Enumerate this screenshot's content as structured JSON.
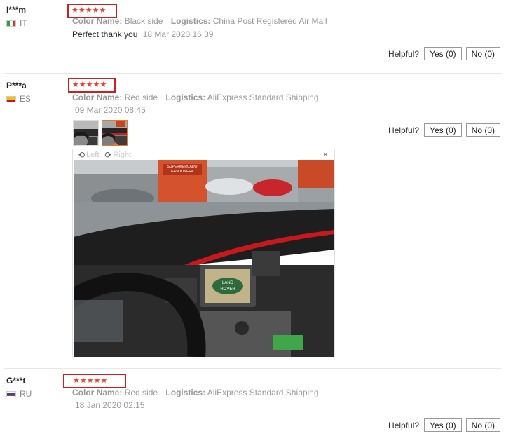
{
  "reviews": [
    {
      "user": "I***m",
      "country": "IT",
      "stars": "★★★★★",
      "meta": [
        {
          "label": "Color Name:",
          "value": "Black side"
        },
        {
          "label": "Logistics:",
          "value": "China Post Registered Air Mail"
        }
      ],
      "feedback": "Perfect thank you",
      "date": "18 Mar 2020 16:39",
      "helpful_label": "Helpful?",
      "yes_label": "Yes (0)",
      "no_label": "No (0)"
    },
    {
      "user": "P***a",
      "country": "ES",
      "stars": "★★★★★",
      "meta": [
        {
          "label": "Color Name:",
          "value": "Red side"
        },
        {
          "label": "Logistics:",
          "value": "AliExpress Standard Shipping"
        }
      ],
      "date": "09 Mar 2020 08:45",
      "helpful_label": "Helpful?",
      "yes_label": "Yes (0)",
      "no_label": "No (0)",
      "viewer": {
        "rotate_left": "Left",
        "rotate_right": "Right",
        "close": "×",
        "photo_text": {
          "sign_top": "SUPERMERCADO",
          "sign_bottom": "GASOLINERA",
          "logo_line1": "LAND",
          "logo_line2": "ROVER"
        }
      }
    },
    {
      "user": "G***t",
      "country": "RU",
      "stars": "★★★★★",
      "meta": [
        {
          "label": "Color Name:",
          "value": "Red side"
        },
        {
          "label": "Logistics:",
          "value": "AliExpress Standard Shipping"
        }
      ],
      "date": "18 Jan 2020 02:15",
      "helpful_label": "Helpful?",
      "yes_label": "Yes (0)",
      "no_label": "No (0)"
    }
  ],
  "colors": {
    "star": "#e8412c",
    "highlight_box": "#cc1f1f",
    "muted_text": "#999999"
  }
}
